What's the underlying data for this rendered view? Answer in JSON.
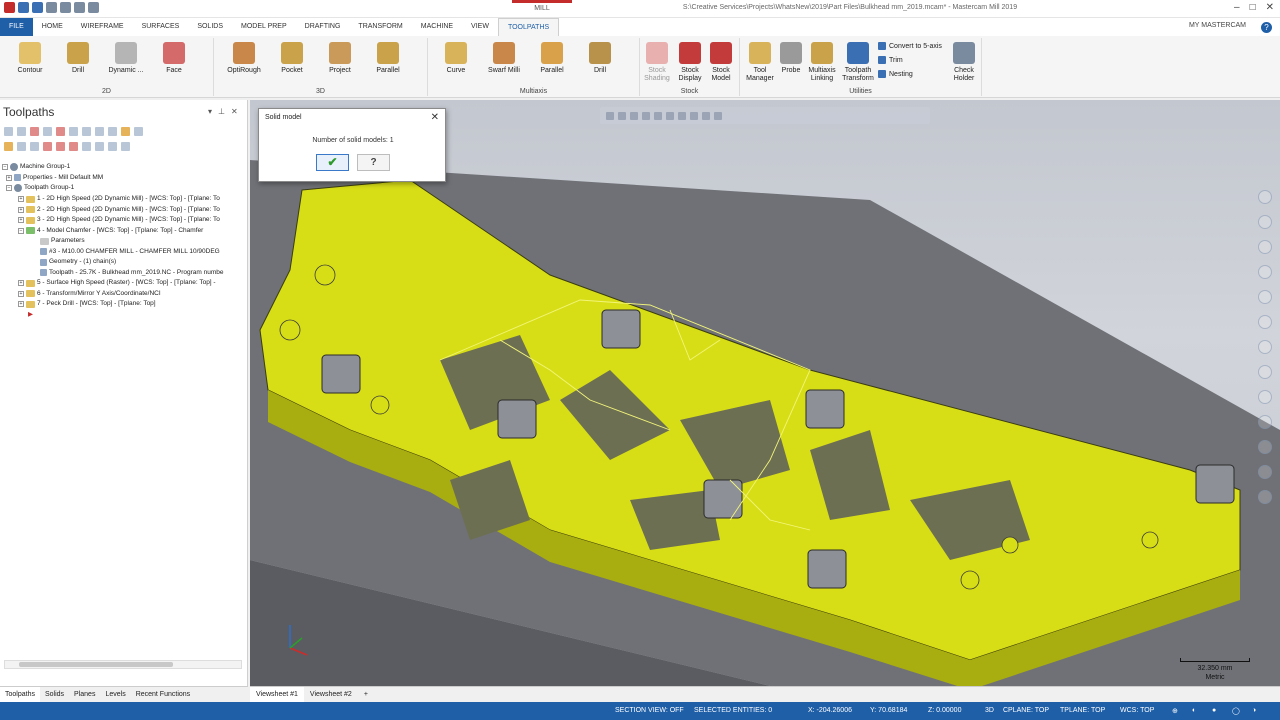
{
  "titlebar": {
    "context_tab": "MILL",
    "document_title": "S:\\Creative Services\\Projects\\WhatsNew\\2019\\Part Files\\Bulkhead mm_2019.mcam* - Mastercam Mill 2019"
  },
  "tabs": [
    "FILE",
    "HOME",
    "WIREFRAME",
    "SURFACES",
    "SOLIDS",
    "MODEL PREP",
    "DRAFTING",
    "TRANSFORM",
    "MACHINE",
    "VIEW",
    "TOOLPATHS"
  ],
  "active_tab": "TOOLPATHS",
  "account": "MY MASTERCAM",
  "ribbon": {
    "groups": {
      "g2d": "2D",
      "g3d": "3D",
      "multiaxis": "Multiaxis",
      "stock": "Stock",
      "utilities": "Utilities"
    },
    "buttons_2d": [
      "Contour",
      "Drill",
      "Dynamic ...",
      "Face"
    ],
    "buttons_3d": [
      "OptiRough",
      "Pocket",
      "Project",
      "Parallel"
    ],
    "buttons_multi": [
      "Curve",
      "Swarf Milli",
      "Parallel",
      "Drill"
    ],
    "buttons_stock": [
      "Stock\nShading",
      "Stock\nDisplay",
      "Stock\nModel"
    ],
    "buttons_util": [
      "Tool\nManager",
      "Probe",
      "Multiaxis\nLinking",
      "Toolpath\nTransform"
    ],
    "util_small": [
      "Convert to 5-axis",
      "Trim",
      "Nesting"
    ],
    "check_holder": "Check\nHolder"
  },
  "panel": {
    "title": "Toolpaths",
    "tree": [
      {
        "text": "Machine Group-1",
        "level": 0
      },
      {
        "text": "Properties - Mill Default MM",
        "level": 1
      },
      {
        "text": "Toolpath Group-1",
        "level": 1
      },
      {
        "text": "1 - 2D High Speed (2D Dynamic Mill) - [WCS: Top] - [Tplane: To",
        "level": 2
      },
      {
        "text": "2 - 2D High Speed (2D Dynamic Mill) - [WCS: Top] - [Tplane: To",
        "level": 2
      },
      {
        "text": "3 - 2D High Speed (2D Dynamic Mill) - [WCS: Top] - [Tplane: To",
        "level": 2
      },
      {
        "text": "4 - Model Chamfer - [WCS: Top] - [Tplane: Top] - Chamfer",
        "level": 2
      },
      {
        "text": "Parameters",
        "level": 3
      },
      {
        "text": "#3 - M10.00 CHAMFER MILL - CHAMFER MILL 10/90DEG",
        "level": 3
      },
      {
        "text": "Geometry - (1) chain(s)",
        "level": 3
      },
      {
        "text": "Toolpath - 25.7K - Bulkhead mm_2019.NC - Program numbe",
        "level": 3
      },
      {
        "text": "5 - Surface High Speed (Raster) - [WCS: Top] - [Tplane: Top] -",
        "level": 2
      },
      {
        "text": "6 - Transform/Mirror Y Axis/Coordinate/NCI",
        "level": 2
      },
      {
        "text": "7 - Peck Drill - [WCS: Top] - [Tplane: Top]",
        "level": 2
      }
    ],
    "bottom_tabs": [
      "Toolpaths",
      "Solids",
      "Planes",
      "Levels",
      "Recent Functions"
    ]
  },
  "viewsheets": [
    "Viewsheet #1",
    "Viewsheet #2",
    "+"
  ],
  "dialog": {
    "title": "Solid model",
    "message": "Number of solid models: 1",
    "ok_glyph": "✔",
    "help_glyph": "?"
  },
  "scale": {
    "value": "32.350 mm",
    "units": "Metric"
  },
  "status": {
    "section_view": "SECTION VIEW: OFF",
    "selected": "SELECTED ENTITIES: 0",
    "x": "X:  -204.26006",
    "y": "Y:  70.68184",
    "z": "Z:  0.00000",
    "mode": "3D",
    "cplane": "CPLANE: TOP",
    "tplane": "TPLANE: TOP",
    "wcs": "WCS: TOP"
  },
  "colors": {
    "accent": "#1f5fa8",
    "part": "#d8de16",
    "fixture": "#6f7177"
  }
}
